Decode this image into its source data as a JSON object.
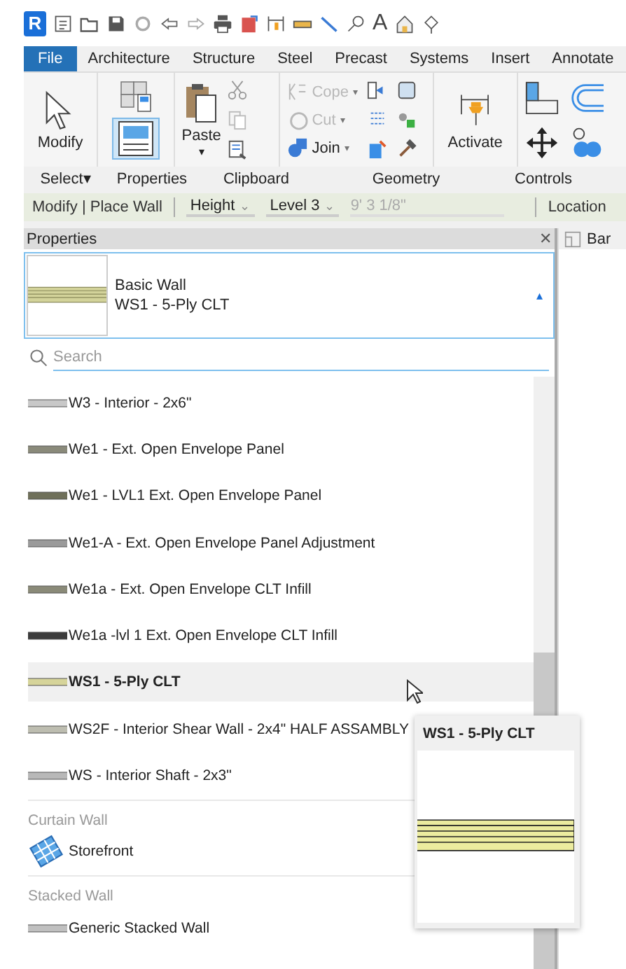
{
  "quick_access": {
    "logo": "R",
    "text_tool": "A"
  },
  "ribbon_tabs": [
    {
      "label": "File",
      "kind": "file"
    },
    {
      "label": "Architecture",
      "kind": "tab"
    },
    {
      "label": "Structure",
      "kind": "tab"
    },
    {
      "label": "Steel",
      "kind": "tab"
    },
    {
      "label": "Precast",
      "kind": "tab"
    },
    {
      "label": "Systems",
      "kind": "tab"
    },
    {
      "label": "Insert",
      "kind": "tab"
    },
    {
      "label": "Annotate",
      "kind": "tab"
    }
  ],
  "ribbon": {
    "modify": "Modify",
    "paste": "Paste",
    "paste_caret": "▾",
    "geometry_tools": [
      {
        "label": "Cope",
        "disabled": true,
        "caret": "▾"
      },
      {
        "label": "Cut",
        "disabled": true,
        "caret": "▾"
      },
      {
        "label": "Join",
        "disabled": false,
        "caret": "▾"
      }
    ],
    "activate": "Activate",
    "panel_labels": [
      {
        "label": "Select",
        "caret": "▾"
      },
      {
        "label": "Properties"
      },
      {
        "label": "Clipboard"
      },
      {
        "label": "Geometry"
      },
      {
        "label": "Controls"
      }
    ]
  },
  "options_bar": {
    "mode": "Modify | Place Wall",
    "height_dropdown": "Height",
    "height_caret": "⌄",
    "level_dropdown": "Level 3",
    "level_caret": "⌄",
    "offset_value": "9'  3 1/8\"",
    "location_label": "Location"
  },
  "properties": {
    "title": "Properties",
    "close": "✕",
    "family": "Basic Wall",
    "type": "WS1 - 5-Ply CLT",
    "collapse": "▴",
    "search_placeholder": "Search",
    "items": [
      {
        "kind": "wall",
        "label": "W3 - Interior - 2x6\"",
        "color": "#c8c8c8",
        "selected": false
      },
      {
        "kind": "wall",
        "label": "We1 - Ext. Open Envelope Panel",
        "color": "#8a8a7a",
        "selected": false
      },
      {
        "kind": "wall",
        "label": "We1 - LVL1 Ext. Open Envelope Panel",
        "color": "#6f705a",
        "selected": false
      },
      {
        "kind": "wall",
        "label": "We1-A - Ext. Open Envelope Panel Adjustment",
        "color": "#9a9a9a",
        "selected": false
      },
      {
        "kind": "wall",
        "label": "We1a - Ext. Open Envelope CLT Infill",
        "color": "#8a8a78",
        "selected": false
      },
      {
        "kind": "wall",
        "label": "We1a -lvl 1 Ext. Open Envelope CLT Infill",
        "color": "#3c3c3c",
        "selected": false
      },
      {
        "kind": "wall",
        "label": "WS1 - 5-Ply CLT",
        "color": "#d6d49a",
        "selected": true
      },
      {
        "kind": "wall",
        "label": "WS2F - Interior Shear Wall - 2x4\" HALF ASSAMBLY",
        "color": "#bdbdb0",
        "selected": false
      },
      {
        "kind": "wall",
        "label": "WS - Interior Shaft - 2x3\"",
        "color": "#b8b8b8",
        "selected": false
      },
      {
        "kind": "group",
        "label": "Curtain Wall"
      },
      {
        "kind": "curtain",
        "label": "Storefront",
        "selected": false
      },
      {
        "kind": "group",
        "label": "Stacked Wall"
      },
      {
        "kind": "wall",
        "label": "Generic Stacked Wall",
        "color": "#c0c0c0",
        "selected": false
      }
    ],
    "tooltip": {
      "title": "WS1 - 5-Ply CLT"
    }
  },
  "view_tab": {
    "label": "Bar"
  }
}
